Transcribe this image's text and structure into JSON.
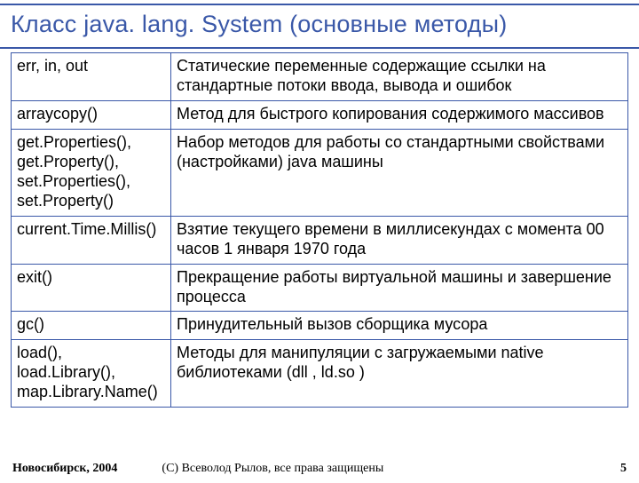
{
  "title": "Класс java. lang. System (основные методы)",
  "rows": [
    {
      "method": "err, in, out",
      "desc": "Статические переменные содержащие ссылки на стандартные потоки ввода, вывода и ошибок"
    },
    {
      "method": "arraycopy()",
      "desc": "Метод для быстрого копирования содержимого массивов"
    },
    {
      "method": "get.Properties(), get.Property(), set.Properties(), set.Property()",
      "desc": "Набор методов для работы со стандартными свойствами (настройками) java машины"
    },
    {
      "method": "current.Time.Millis()",
      "desc": "Взятие текущего времени в миллисекундах с момента 00 часов 1 января 1970 года"
    },
    {
      "method": "exit()",
      "desc": "Прекращение работы виртуальной машины и завершение процесса"
    },
    {
      "method": "gc()",
      "desc": "Принудительный вызов сборщика мусора"
    },
    {
      "method": "load(), load.Library(), map.Library.Name()",
      "desc": "Методы для манипуляции с загружаемыми native библиотеками (dll , ld.so )"
    }
  ],
  "footer": {
    "left": "Новосибирск, 2004",
    "center": "(С) Всеволод Рылов, все права защищены",
    "right": "5"
  }
}
